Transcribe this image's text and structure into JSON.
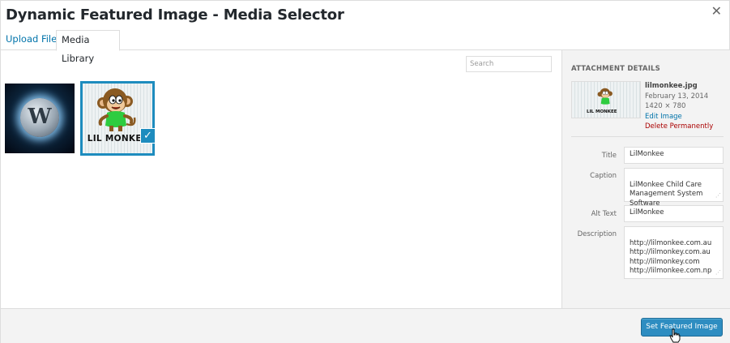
{
  "modal": {
    "title": "Dynamic Featured Image - Media Selector",
    "close_icon": "close-icon"
  },
  "tabs": [
    {
      "label": "Upload Files"
    },
    {
      "label": "Media Library"
    }
  ],
  "browser": {
    "search_placeholder": "Search",
    "items": [
      {
        "icon": "wordpress-logo-thumbnail",
        "selected": false
      },
      {
        "icon": "lilmonkee-thumbnail",
        "logo_text": "LIL MONKEE",
        "selected": true
      }
    ]
  },
  "attachment": {
    "heading": "ATTACHMENT DETAILS",
    "thumb_logo_text": "LIL MONKEE",
    "filename": "lilmonkee.jpg",
    "date": "February 13, 2014",
    "dimensions": "1420 × 780",
    "edit_link": "Edit Image",
    "delete_link": "Delete Permanently",
    "fields": {
      "title_label": "Title",
      "title_value": "LilMonkee",
      "caption_label": "Caption",
      "caption_value": "LilMonkee Child Care\nManagement System\nSoftware",
      "alt_label": "Alt Text",
      "alt_value": "LilMonkee",
      "description_label": "Description",
      "description_value": "http://lilmonkee.com.au\nhttp://lilmonkey.com.au\nhttp://lilmonkey.com\nhttp://lilmonkee.com.np"
    }
  },
  "footer": {
    "button_label": "Set Featured Image"
  },
  "colors": {
    "accent": "#0073aa",
    "primary_button": "#2e8dc1",
    "selected_border": "#1e8cbe",
    "delete": "#aa0000"
  }
}
